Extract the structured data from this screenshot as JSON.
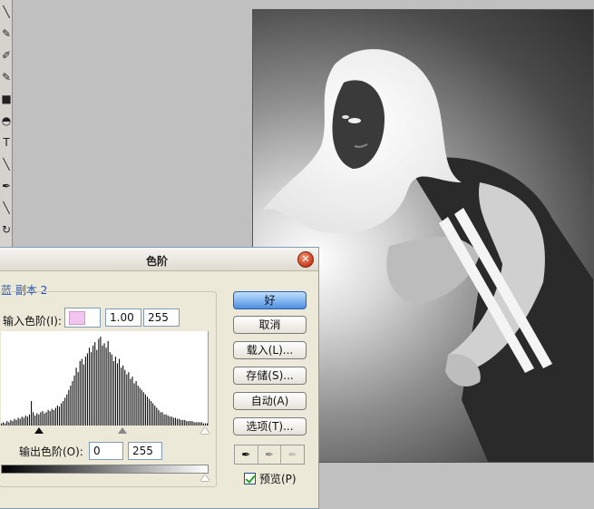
{
  "dialog": {
    "title": "色阶",
    "channel": "蓝 副本 2",
    "input_label": "输入色阶(I):",
    "input_gamma": "1.00",
    "input_white": "255",
    "output_label": "输出色阶(O):",
    "output_black": "0",
    "output_white": "255",
    "buttons": {
      "ok": "好",
      "cancel": "取消",
      "load": "载入(L)...",
      "save": "存储(S)...",
      "auto": "自动(A)",
      "options": "选项(T)..."
    },
    "preview_label": "预览(P)",
    "preview_checked": true,
    "swatch_color": "#f1c6ee"
  },
  "toolbox": {
    "tools": [
      "brush-icon",
      "pencil-icon",
      "clone-icon",
      "eraser-icon",
      "gradient-icon",
      "pen-icon",
      "type-icon",
      "line-icon",
      "eyedropper-icon",
      "magnify-icon",
      "rotate-icon"
    ],
    "type_glyph": "T"
  },
  "histogram": {
    "values": [
      2,
      3,
      2,
      4,
      3,
      5,
      4,
      6,
      5,
      7,
      6,
      8,
      7,
      9,
      8,
      10,
      22,
      12,
      9,
      11,
      10,
      12,
      13,
      11,
      12,
      14,
      13,
      15,
      14,
      16,
      18,
      17,
      20,
      22,
      25,
      28,
      32,
      36,
      40,
      45,
      52,
      48,
      58,
      60,
      55,
      62,
      65,
      70,
      66,
      72,
      75,
      68,
      78,
      80,
      72,
      74,
      70,
      76,
      66,
      64,
      58,
      62,
      56,
      60,
      52,
      54,
      50,
      46,
      48,
      42,
      44,
      38,
      40,
      36,
      34,
      32,
      30,
      28,
      26,
      24,
      22,
      20,
      18,
      16,
      14,
      12,
      12,
      10,
      10,
      9,
      8,
      8,
      7,
      7,
      6,
      6,
      5,
      5,
      5,
      4,
      4,
      4,
      4,
      3,
      3,
      3,
      3,
      3,
      2,
      2,
      2
    ]
  }
}
